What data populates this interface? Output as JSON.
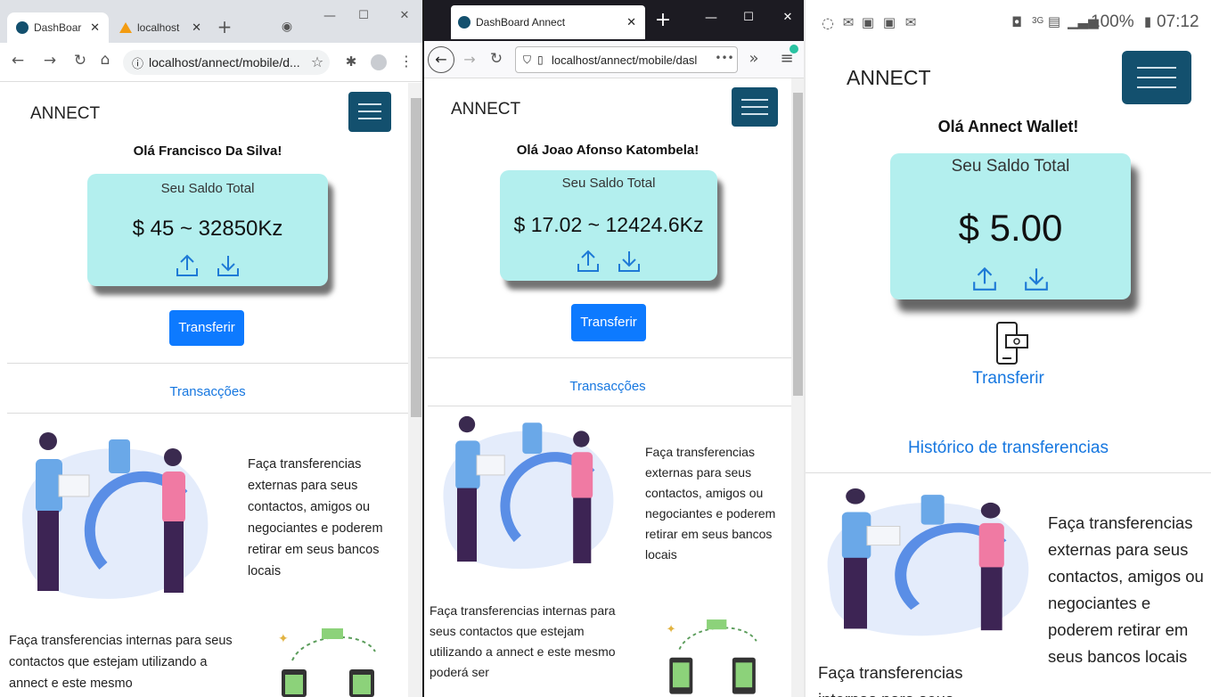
{
  "chrome": {
    "tab1_title": "DashBoar",
    "tab2_title": "localhost",
    "new_tab": "+",
    "url": "localhost/annect/mobile/d..."
  },
  "firefox": {
    "tab_title": "DashBoard Annect",
    "url": "localhost/annect/mobile/dasl",
    "more": "•••",
    "overflow": "»"
  },
  "android": {
    "battery": "100%",
    "time": "07:12",
    "network": "3G"
  },
  "screen1": {
    "brand": "ANNECT",
    "greeting": "Olá Francisco Da Silva!",
    "balance_label": "Seu Saldo Total",
    "balance": "$ 45 ~ 32850Kz",
    "transfer_button": "Transferir",
    "transactions_link": "Transacções",
    "para1": "Faça transferencias externas para seus contactos, amigos ou negociantes e poderem retirar em seus bancos locais",
    "para2": "Faça transferencias internas para seus contactos que estejam utilizando a annect e este mesmo"
  },
  "screen2": {
    "brand": "ANNECT",
    "greeting": "Olá Joao Afonso Katombela!",
    "balance_label": "Seu Saldo Total",
    "balance": "$ 17.02 ~ 12424.6Kz",
    "transfer_button": "Transferir",
    "transactions_link": "Transacções",
    "para1": "Faça transferencias externas para seus contactos, amigos ou negociantes e poderem retirar em seus bancos locais",
    "para2": "Faça transferencias internas para seus contactos que estejam utilizando a annect e este mesmo poderá ser"
  },
  "screen3": {
    "brand": "ANNECT",
    "greeting": "Olá Annect Wallet!",
    "balance_label": "Seu Saldo Total",
    "balance": "$ 5.00",
    "transfer_link": "Transferir",
    "history_link": "Histórico de transferencias",
    "para1": "Faça transferencias externas para seus contactos, amigos ou negociantes e poderem retirar em seus bancos locais",
    "para2": "Faça transferencias internas para seus"
  },
  "colors": {
    "navbar_toggle": "#13506e",
    "card": "#b3efee",
    "primary": "#0d7aff",
    "link": "#1677e0"
  }
}
